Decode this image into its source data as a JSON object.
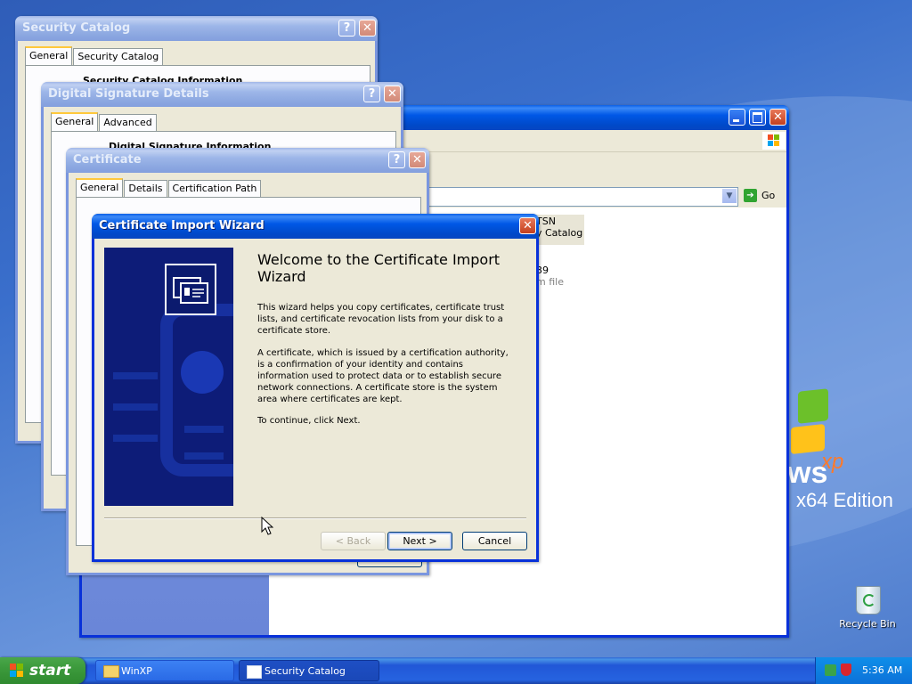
{
  "desktop": {
    "brand_xp": "xp",
    "brand_ws": "ws",
    "brand_edition": "x64 Edition",
    "recycle_bin": "Recycle Bin"
  },
  "explorer": {
    "go_label": "Go",
    "file1_name": "TSN",
    "file1_type": "y Catalog",
    "file2_name": "39",
    "file2_type": "m file"
  },
  "sec_catalog": {
    "title": "Security Catalog",
    "tabs": [
      "General",
      "Security Catalog"
    ],
    "heading": "Security Catalog Information"
  },
  "dig_sig": {
    "title": "Digital Signature Details",
    "tabs": [
      "General",
      "Advanced"
    ],
    "heading": "Digital Signature Information"
  },
  "certificate": {
    "title": "Certificate",
    "tabs": [
      "General",
      "Details",
      "Certification Path"
    ]
  },
  "wizard": {
    "title": "Certificate Import Wizard",
    "heading": "Welcome to the Certificate Import Wizard",
    "para1": "This wizard helps you copy certificates, certificate trust lists, and certificate revocation lists from your disk to a certificate store.",
    "para2": "A certificate, which is issued by a certification authority, is a confirmation of your identity and contains information used to protect data or to establish secure network connections. A certificate store is the system area where certificates are kept.",
    "para3": "To continue, click Next.",
    "back_label": "< Back",
    "next_label": "Next >",
    "cancel_label": "Cancel"
  },
  "taskbar": {
    "start_label": "start",
    "items": [
      "WinXP",
      "Security Catalog"
    ],
    "clock": "5:36 AM"
  },
  "colors": {
    "titlebar_active": "#0058e6",
    "window_face": "#ece9d8",
    "taskbar": "#245edb",
    "start_green": "#3c9a3c"
  }
}
